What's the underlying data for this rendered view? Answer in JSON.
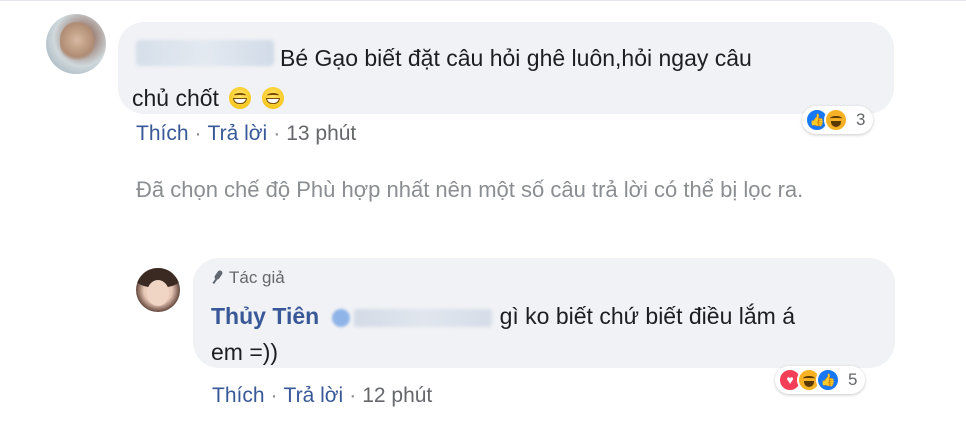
{
  "comment": {
    "author": "Hoàng Trinh",
    "text_line1": "Bé Gạo biết đặt câu hỏi ghê luôn,hỏi ngay câu",
    "text_line2": "chủ chốt",
    "emoji": "grin-face",
    "reactions": {
      "icons": [
        "like-icon",
        "haha-icon"
      ],
      "count": "3"
    },
    "actions": {
      "like": "Thích",
      "reply": "Trả lời",
      "time": "13 phút",
      "separator": "·"
    }
  },
  "filter_notice": "Đã chọn chế độ Phù hợp nhất nên một số câu trả lời có thể bị lọc ra.",
  "reply": {
    "badge": "Tác giả",
    "author": "Thủy Tiên",
    "mention": "Hoàng Trinh",
    "text_line1": "gì ko biết chứ biết điều lắm á",
    "text_line2": "em =))",
    "reactions": {
      "icons": [
        "love-icon",
        "haha-icon",
        "like-icon"
      ],
      "count": "5"
    },
    "actions": {
      "like": "Thích",
      "reply": "Trả lời",
      "time": "12 phút",
      "separator": "·"
    }
  },
  "colors": {
    "link": "#385898",
    "meta": "#65676b",
    "bubble": "#f0f2f5",
    "like": "#1877f2",
    "haha": "#f7b125",
    "love": "#f33e58"
  }
}
